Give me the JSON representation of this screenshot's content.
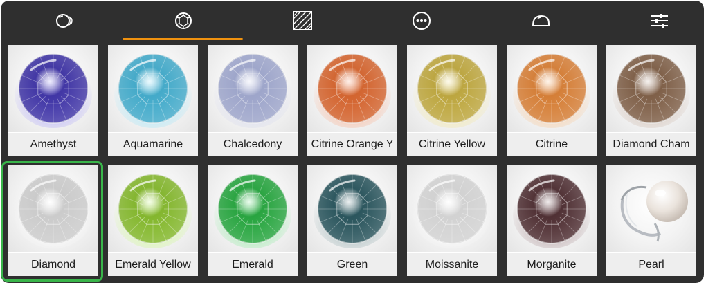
{
  "toolbar": {
    "tabs": [
      {
        "name": "tab-gem-coin",
        "icon": "gem-coin-icon"
      },
      {
        "name": "tab-gemstone",
        "icon": "gemstone-facet-icon",
        "active": true
      },
      {
        "name": "tab-texture",
        "icon": "texture-hatch-icon"
      },
      {
        "name": "tab-more",
        "icon": "more-dots-icon"
      },
      {
        "name": "tab-cabochon",
        "icon": "cabochon-icon"
      },
      {
        "name": "tab-adjust",
        "icon": "sliders-icon"
      }
    ],
    "accent_color": "#f0920f"
  },
  "materials": [
    {
      "label": "Amethyst",
      "color": "#3a2fa0",
      "glow": "#6a5cff"
    },
    {
      "label": "Aquamarine",
      "color": "#3ea6c6",
      "glow": "#4fd6ff"
    },
    {
      "label": "Chalcedony",
      "color": "#9aa2c8",
      "glow": "#b7bde6"
    },
    {
      "label": "Citrine Orange Y",
      "color": "#d0602a",
      "glow": "#ff6a2a"
    },
    {
      "label": "Citrine Yellow",
      "color": "#b9a23a",
      "glow": "#f2d84a"
    },
    {
      "label": "Citrine",
      "color": "#d27a32",
      "glow": "#ff9a3a"
    },
    {
      "label": "Diamond Cham",
      "color": "#7a5a42",
      "glow": "#a88066"
    },
    {
      "label": "Diamond",
      "color": "#c8c8c8",
      "glow": "#ffffff",
      "selected": true
    },
    {
      "label": "Emerald Yellow",
      "color": "#7fb228",
      "glow": "#a6ff2a"
    },
    {
      "label": "Emerald",
      "color": "#22a03a",
      "glow": "#2ee050"
    },
    {
      "label": "Green",
      "color": "#245058",
      "glow": "#3c6a70"
    },
    {
      "label": "Moissanite",
      "color": "#cfcfcf",
      "glow": "#ffffff"
    },
    {
      "label": "Morganite",
      "color": "#4a2a2e",
      "glow": "#6a3a40"
    },
    {
      "label": "Pearl",
      "color": "#f1ece6",
      "glow": "#ffffff",
      "kind": "pearl-ring"
    }
  ],
  "selection_color": "#39b54a"
}
